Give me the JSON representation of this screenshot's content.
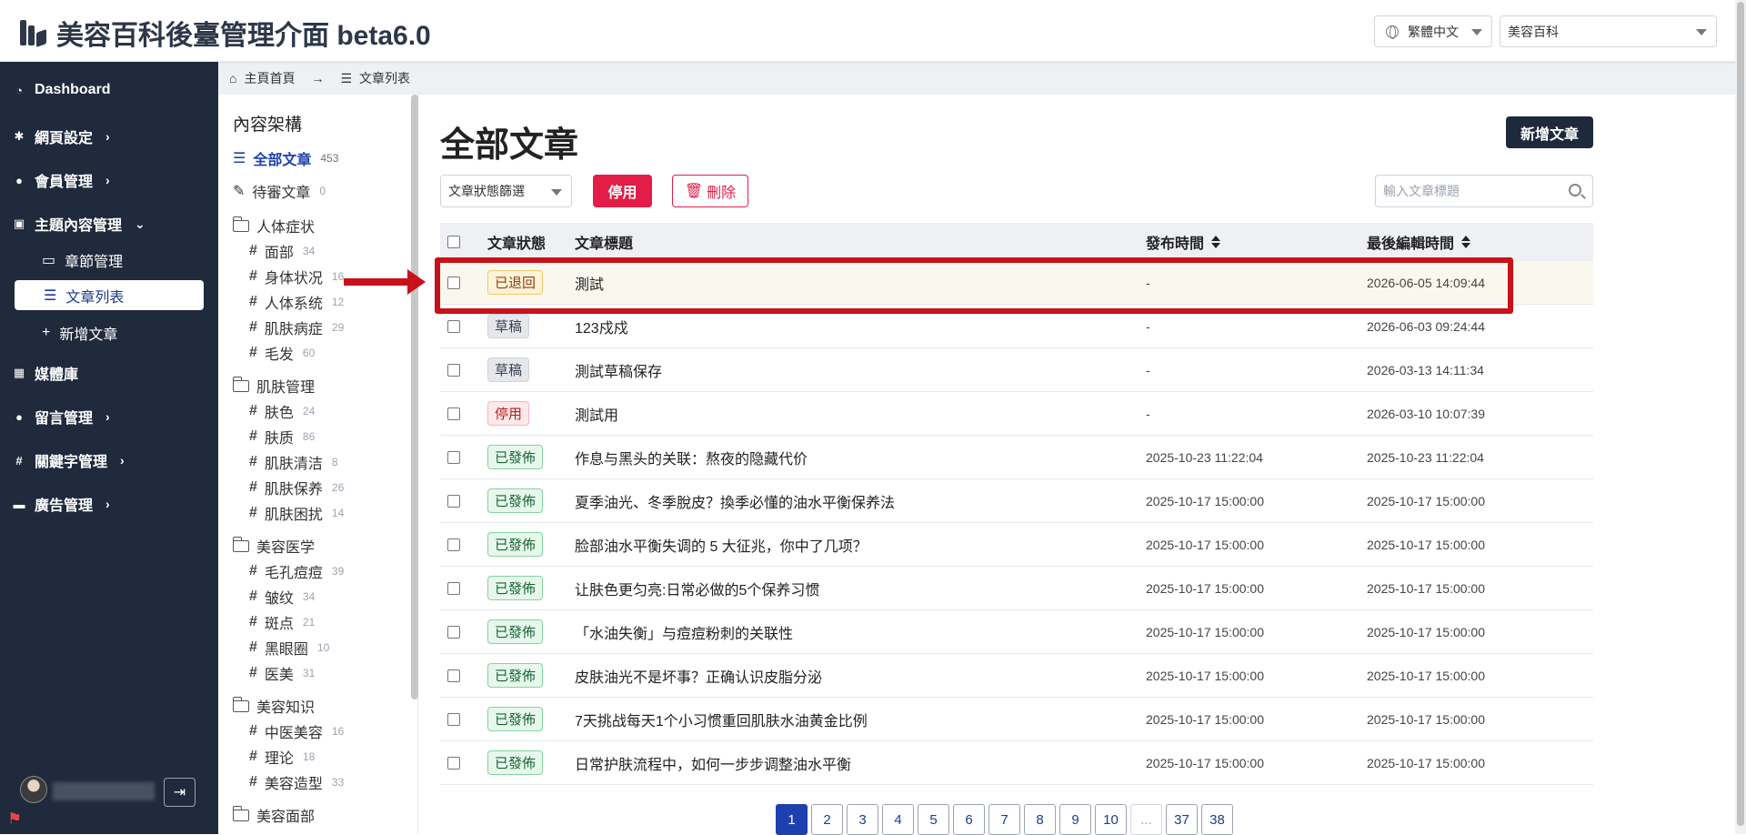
{
  "app": {
    "title": "美容百科後臺管理介面 beta6.0"
  },
  "header": {
    "language": "繁體中文",
    "site": "美容百科"
  },
  "sidebar": {
    "items": [
      {
        "label": "Dashboard",
        "icon": "dashboard-icon"
      },
      {
        "label": "網頁設定",
        "icon": "gear-icon"
      },
      {
        "label": "會員管理",
        "icon": "users-icon"
      },
      {
        "label": "主題內容管理",
        "icon": "content-icon"
      },
      {
        "label": "媒體庫",
        "icon": "media-icon"
      },
      {
        "label": "留言管理",
        "icon": "comment-icon"
      },
      {
        "label": "關鍵字管理",
        "icon": "hash-icon"
      },
      {
        "label": "廣告管理",
        "icon": "ad-icon"
      }
    ],
    "sub": {
      "chapters": "章節管理",
      "articles": "文章列表",
      "new_article": "新增文章"
    }
  },
  "breadcrumb": {
    "home": "主頁首頁",
    "current": "文章列表"
  },
  "categories": {
    "title": "內容架構",
    "all": {
      "label": "全部文章",
      "count": "453"
    },
    "pending": {
      "label": "待審文章",
      "count": "0"
    },
    "groups": [
      {
        "label": "人体症状",
        "children": [
          {
            "label": "面部",
            "count": "34"
          },
          {
            "label": "身体状况",
            "count": "16"
          },
          {
            "label": "人体系统",
            "count": "12"
          },
          {
            "label": "肌肤病症",
            "count": "29"
          },
          {
            "label": "毛发",
            "count": "60"
          }
        ]
      },
      {
        "label": "肌肤管理",
        "children": [
          {
            "label": "肤色",
            "count": "24"
          },
          {
            "label": "肤质",
            "count": "86"
          },
          {
            "label": "肌肤清洁",
            "count": "8"
          },
          {
            "label": "肌肤保养",
            "count": "26"
          },
          {
            "label": "肌肤困扰",
            "count": "14"
          }
        ]
      },
      {
        "label": "美容医学",
        "children": [
          {
            "label": "毛孔痘痘",
            "count": "39"
          },
          {
            "label": "皱纹",
            "count": "34"
          },
          {
            "label": "斑点",
            "count": "21"
          },
          {
            "label": "黑眼圈",
            "count": "10"
          },
          {
            "label": "医美",
            "count": "31"
          }
        ]
      },
      {
        "label": "美容知识",
        "children": [
          {
            "label": "中医美容",
            "count": "16"
          },
          {
            "label": "理论",
            "count": "18"
          },
          {
            "label": "美容造型",
            "count": "33"
          }
        ]
      },
      {
        "label": "美容面部",
        "children": []
      }
    ]
  },
  "main": {
    "title": "全部文章",
    "new_button": "新增文章",
    "status_filter": "文章狀態篩選",
    "stop_button": "停用",
    "delete_button": "刪除",
    "search_placeholder": "輸入文章標題",
    "columns": {
      "status": "文章狀態",
      "title": "文章標題",
      "published": "發布時間",
      "edited": "最後編輯時間"
    },
    "rows": [
      {
        "status": "已退回",
        "status_type": "returned",
        "title": "測試",
        "published": "-",
        "edited": "2026-06-05 14:09:44"
      },
      {
        "status": "草稿",
        "status_type": "draft",
        "title": "123戍戍",
        "published": "-",
        "edited": "2026-06-03 09:24:44"
      },
      {
        "status": "草稿",
        "status_type": "draft",
        "title": "測試草稿保存",
        "published": "-",
        "edited": "2026-03-13 14:11:34"
      },
      {
        "status": "停用",
        "status_type": "disabled",
        "title": "測試用",
        "published": "-",
        "edited": "2026-03-10 10:07:39"
      },
      {
        "status": "已發佈",
        "status_type": "published",
        "title": "作息与黑头的关联：熬夜的隐藏代价",
        "published": "2025-10-23 11:22:04",
        "edited": "2025-10-23 11:22:04"
      },
      {
        "status": "已發佈",
        "status_type": "published",
        "title": "夏季油光、冬季脫皮？換季必懂的油水平衡保养法",
        "published": "2025-10-17 15:00:00",
        "edited": "2025-10-17 15:00:00"
      },
      {
        "status": "已發佈",
        "status_type": "published",
        "title": "脸部油水平衡失调的 5 大征兆，你中了几项？",
        "published": "2025-10-17 15:00:00",
        "edited": "2025-10-17 15:00:00"
      },
      {
        "status": "已發佈",
        "status_type": "published",
        "title": "让肤色更匀亮:日常必做的5个保养习惯",
        "published": "2025-10-17 15:00:00",
        "edited": "2025-10-17 15:00:00"
      },
      {
        "status": "已發佈",
        "status_type": "published",
        "title": "「水油失衡」与痘痘粉刺的关联性",
        "published": "2025-10-17 15:00:00",
        "edited": "2025-10-17 15:00:00"
      },
      {
        "status": "已發佈",
        "status_type": "published",
        "title": "皮肤油光不是坏事？正确认识皮脂分泌",
        "published": "2025-10-17 15:00:00",
        "edited": "2025-10-17 15:00:00"
      },
      {
        "status": "已發佈",
        "status_type": "published",
        "title": "7天挑战每天1个小习惯重回肌肤水油黄金比例",
        "published": "2025-10-17 15:00:00",
        "edited": "2025-10-17 15:00:00"
      },
      {
        "status": "已發佈",
        "status_type": "published",
        "title": "日常护肤流程中，如何一步步调整油水平衡",
        "published": "2025-10-17 15:00:00",
        "edited": "2025-10-17 15:00:00"
      }
    ],
    "pagination": [
      "1",
      "2",
      "3",
      "4",
      "5",
      "6",
      "7",
      "8",
      "9",
      "10",
      "...",
      "37",
      "38"
    ],
    "current_page": "1"
  },
  "colors": {
    "sidebar_bg": "#1f2a3c",
    "accent": "#1e40af",
    "danger": "#e11d48",
    "annotation": "#c8111a"
  }
}
